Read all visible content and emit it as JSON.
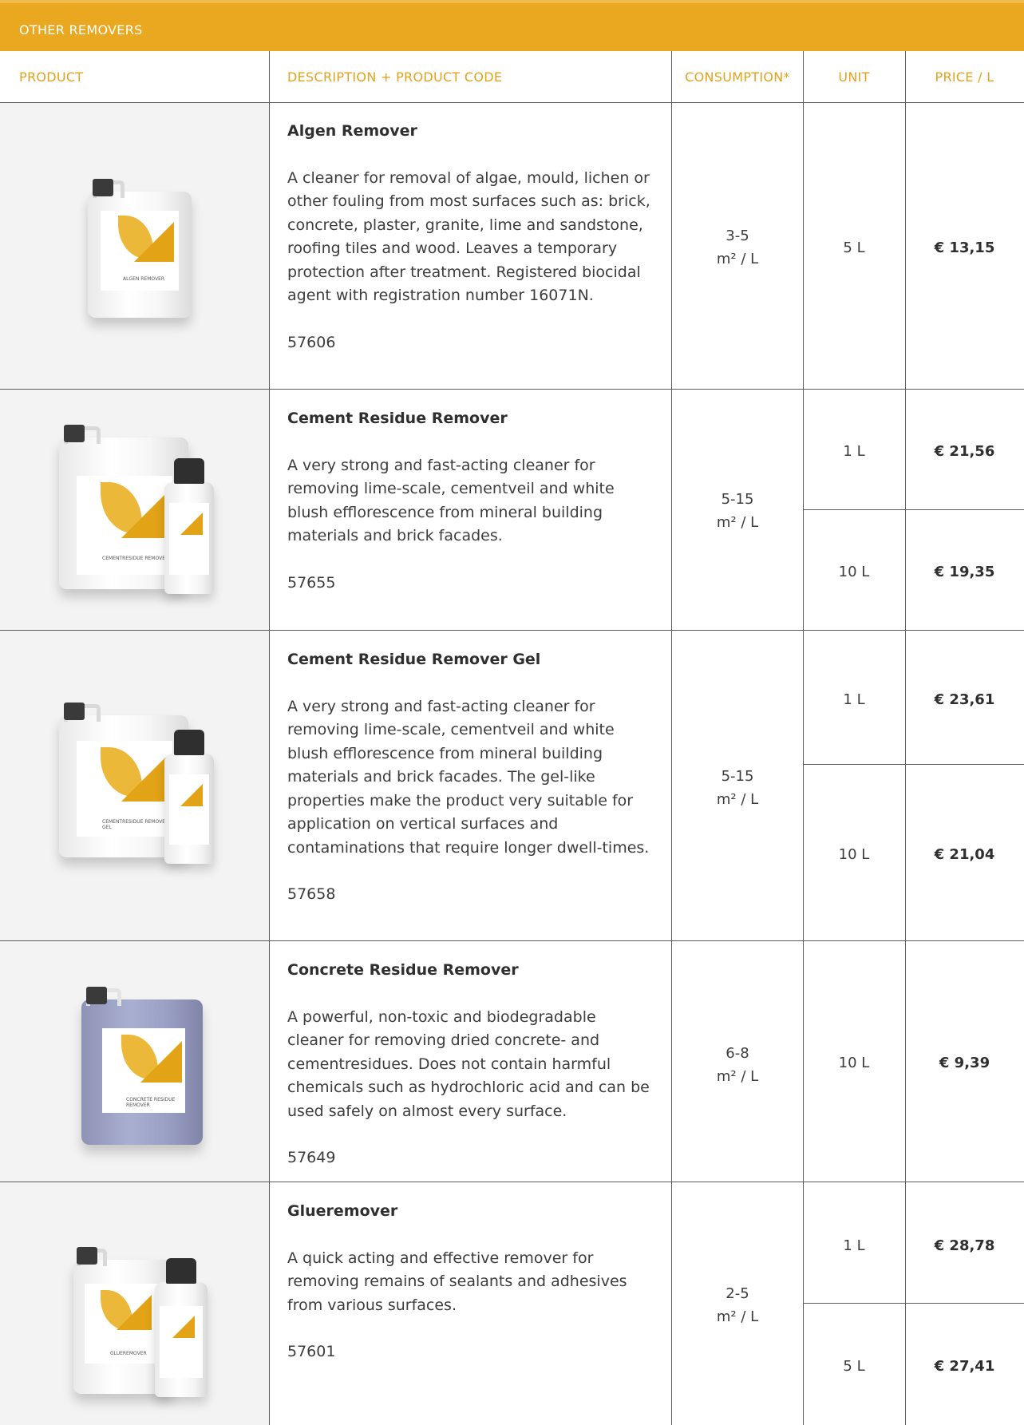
{
  "section": {
    "title": "OTHER REMOVERS"
  },
  "columns": {
    "product": "PRODUCT",
    "description": "DESCRIPTION + PRODUCT CODE",
    "consumption": "CONSUMPTION*",
    "unit": "UNIT",
    "price": "PRICE / L"
  },
  "products": [
    {
      "name": "Algen Remover",
      "description": "A cleaner for removal of algae, mould, lichen or other fouling from most surfaces such as: brick, concrete, plaster, granite, lime and sandstone, roofing tiles and wood. Leaves a temporary protection after treatment. Registered biocidal agent with registration number 16071N.",
      "code": "57606",
      "consumption_range": "3-5",
      "consumption_unit": "m² / L",
      "label_text": "ALGEN REMOVER",
      "options": [
        {
          "unit": "5 L",
          "price": "€ 13,15"
        }
      ]
    },
    {
      "name": "Cement Residue Remover",
      "description": "A very strong and fast-acting cleaner for removing lime-scale, cementveil and white blush efflorescence from mineral building materials and brick facades.",
      "code": "57655",
      "consumption_range": "5-15",
      "consumption_unit": "m² / L",
      "label_text": "CEMENTRESIDUE REMOVER",
      "options": [
        {
          "unit": "1 L",
          "price": "€ 21,56"
        },
        {
          "unit": "10 L",
          "price": "€ 19,35"
        }
      ]
    },
    {
      "name": "Cement Residue Remover Gel",
      "description": "A very strong and fast-acting cleaner for removing lime-scale, cementveil and white blush efflorescence from mineral building materials and brick facades. The gel-like properties make the product very suitable for application on vertical surfaces and contaminations that require longer dwell-times.",
      "code": "57658",
      "consumption_range": "5-15",
      "consumption_unit": "m² / L",
      "label_text": "CEMENTRESIDUE REMOVER GEL",
      "options": [
        {
          "unit": "1 L",
          "price": "€ 23,61"
        },
        {
          "unit": "10 L",
          "price": "€ 21,04"
        }
      ]
    },
    {
      "name": "Concrete Residue Remover",
      "description": "A powerful, non-toxic and biodegradable cleaner for removing dried concrete- and cementresidues. Does not contain harmful chemicals such as hydrochloric acid and can be used safely on almost every surface.",
      "code": "57649",
      "consumption_range": "6-8",
      "consumption_unit": "m² / L",
      "label_text": "CONCRETE RESIDUE REMOVER",
      "options": [
        {
          "unit": "10 L",
          "price": "€ 9,39"
        }
      ]
    },
    {
      "name": "Glueremover",
      "description": "A quick acting and effective remover for removing remains of sealants and adhesives from various surfaces.",
      "code": "57601",
      "consumption_range": "2-5",
      "consumption_unit": "m² / L",
      "label_text": "GLUEREMOVER",
      "options": [
        {
          "unit": "1 L",
          "price": "€ 28,78"
        },
        {
          "unit": "5 L",
          "price": "€ 27,41"
        }
      ]
    }
  ],
  "colors": {
    "accent": "#e9a820",
    "header_text": "#e3a21c",
    "rule": "#5c5c5c"
  }
}
